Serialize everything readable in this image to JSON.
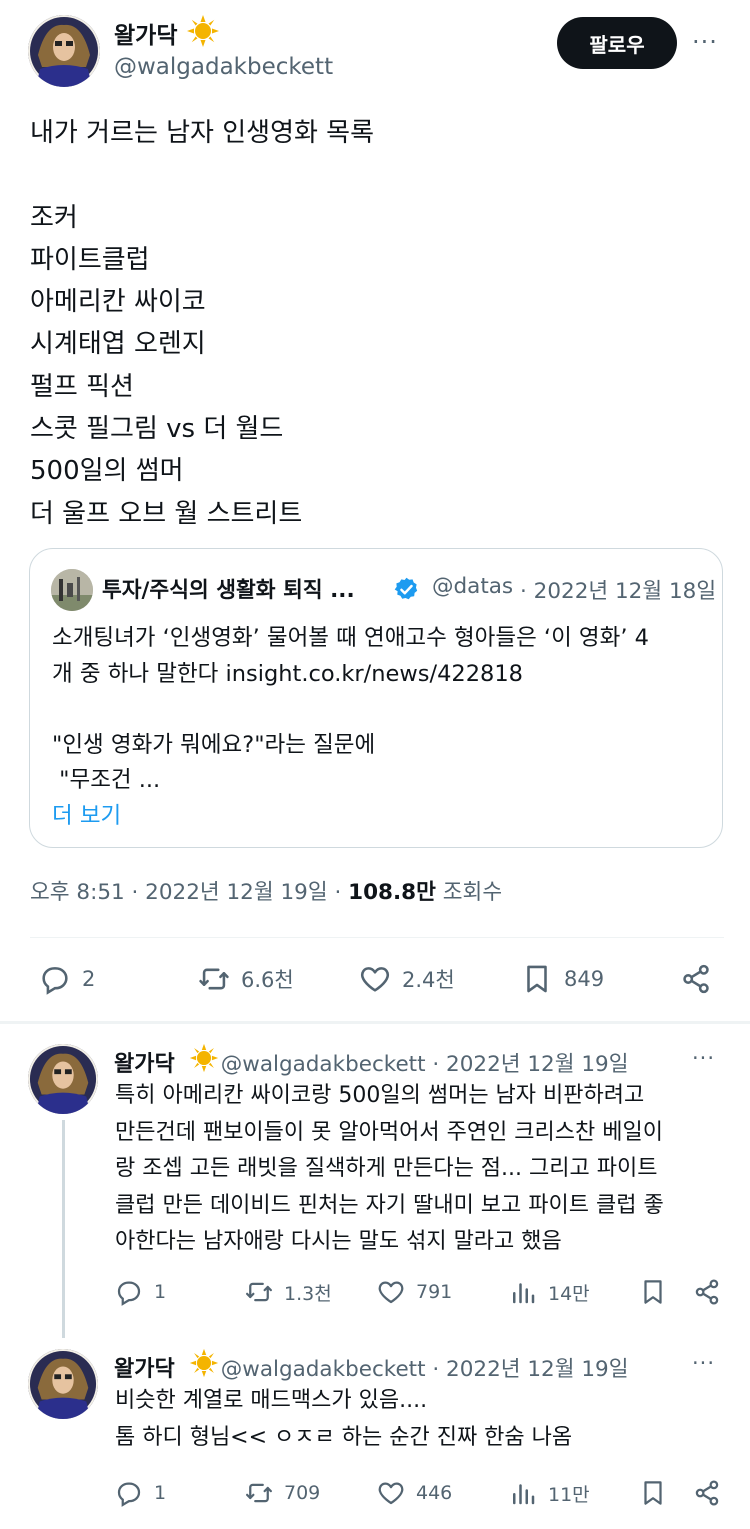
{
  "main_tweet": {
    "author_name": "왈가닥",
    "author_handle": "@walgadakbeckett",
    "follow_label": "팔로우",
    "more_label": "···",
    "body_lines": [
      "내가 거르는 남자 인생영화 목록",
      "",
      "조커",
      "파이트클럽",
      "아메리칸 싸이코",
      "시계태엽 오렌지",
      "펄프 픽션",
      "스콧 필그림 vs 더 월드",
      "500일의 썸머",
      "더 울프 오브 월 스트리트"
    ],
    "timestamp": "오후 8:51 · 2022년 12월 19일",
    "views_sep": " · ",
    "views_count": "108.8만",
    "views_label": " 조회수",
    "actions": {
      "replies": "2",
      "retweets": "6.6천",
      "likes": "2.4천",
      "bookmarks": "849"
    }
  },
  "quote": {
    "author_name": "투자/주식의 생활화 퇴직 ...",
    "handle": "@datas",
    "date": "· 2022년 12월 18일",
    "text_lines": [
      "소개팅녀가 ‘인생영화’ 물어볼 때 연애고수 형아들은 ‘이 영화’ 4",
      "개 중 하나 말한다 insight.co.kr/news/422818",
      "",
      "\"인생 영화가 뭐에요?\"라는 질문에",
      " \"무조건 ..."
    ],
    "more_label": "더 보기"
  },
  "replies": [
    {
      "author_name": "왈가닥",
      "handle": "@walgadakbeckett",
      "date": "· 2022년 12월 19일",
      "more_label": "···",
      "text_lines": [
        "특히 아메리칸 싸이코랑 500일의 썸머는 남자 비판하려고",
        "만든건데 팬보이들이 못 알아먹어서 주연인 크리스찬 베일이",
        "랑 조셉 고든 래빗을 질색하게 만든다는 점... 그리고 파이트",
        "클럽 만든 데이비드 핀처는 자기 딸내미 보고 파이트 클럽 좋",
        "아한다는 남자애랑 다시는 말도 섞지 말라고 했음"
      ],
      "actions": {
        "replies": "1",
        "retweets": "1.3천",
        "likes": "791",
        "views": "14만"
      }
    },
    {
      "author_name": "왈가닥",
      "handle": "@walgadakbeckett",
      "date": "· 2022년 12월 19일",
      "more_label": "···",
      "text_lines": [
        "비슷한 계열로 매드맥스가 있음....",
        "톰 하디 형님<< ㅇㅈㄹ 하는 순간 진짜 한숨 나옴"
      ],
      "actions": {
        "replies": "1",
        "retweets": "709",
        "likes": "446",
        "views": "11만"
      }
    }
  ],
  "colors": {
    "text": "#0f1419",
    "secondary": "#536471",
    "link": "#1d9bf0",
    "border": "#cfd9de",
    "verified": "#1d9bf0",
    "sun": "#f4b400"
  }
}
